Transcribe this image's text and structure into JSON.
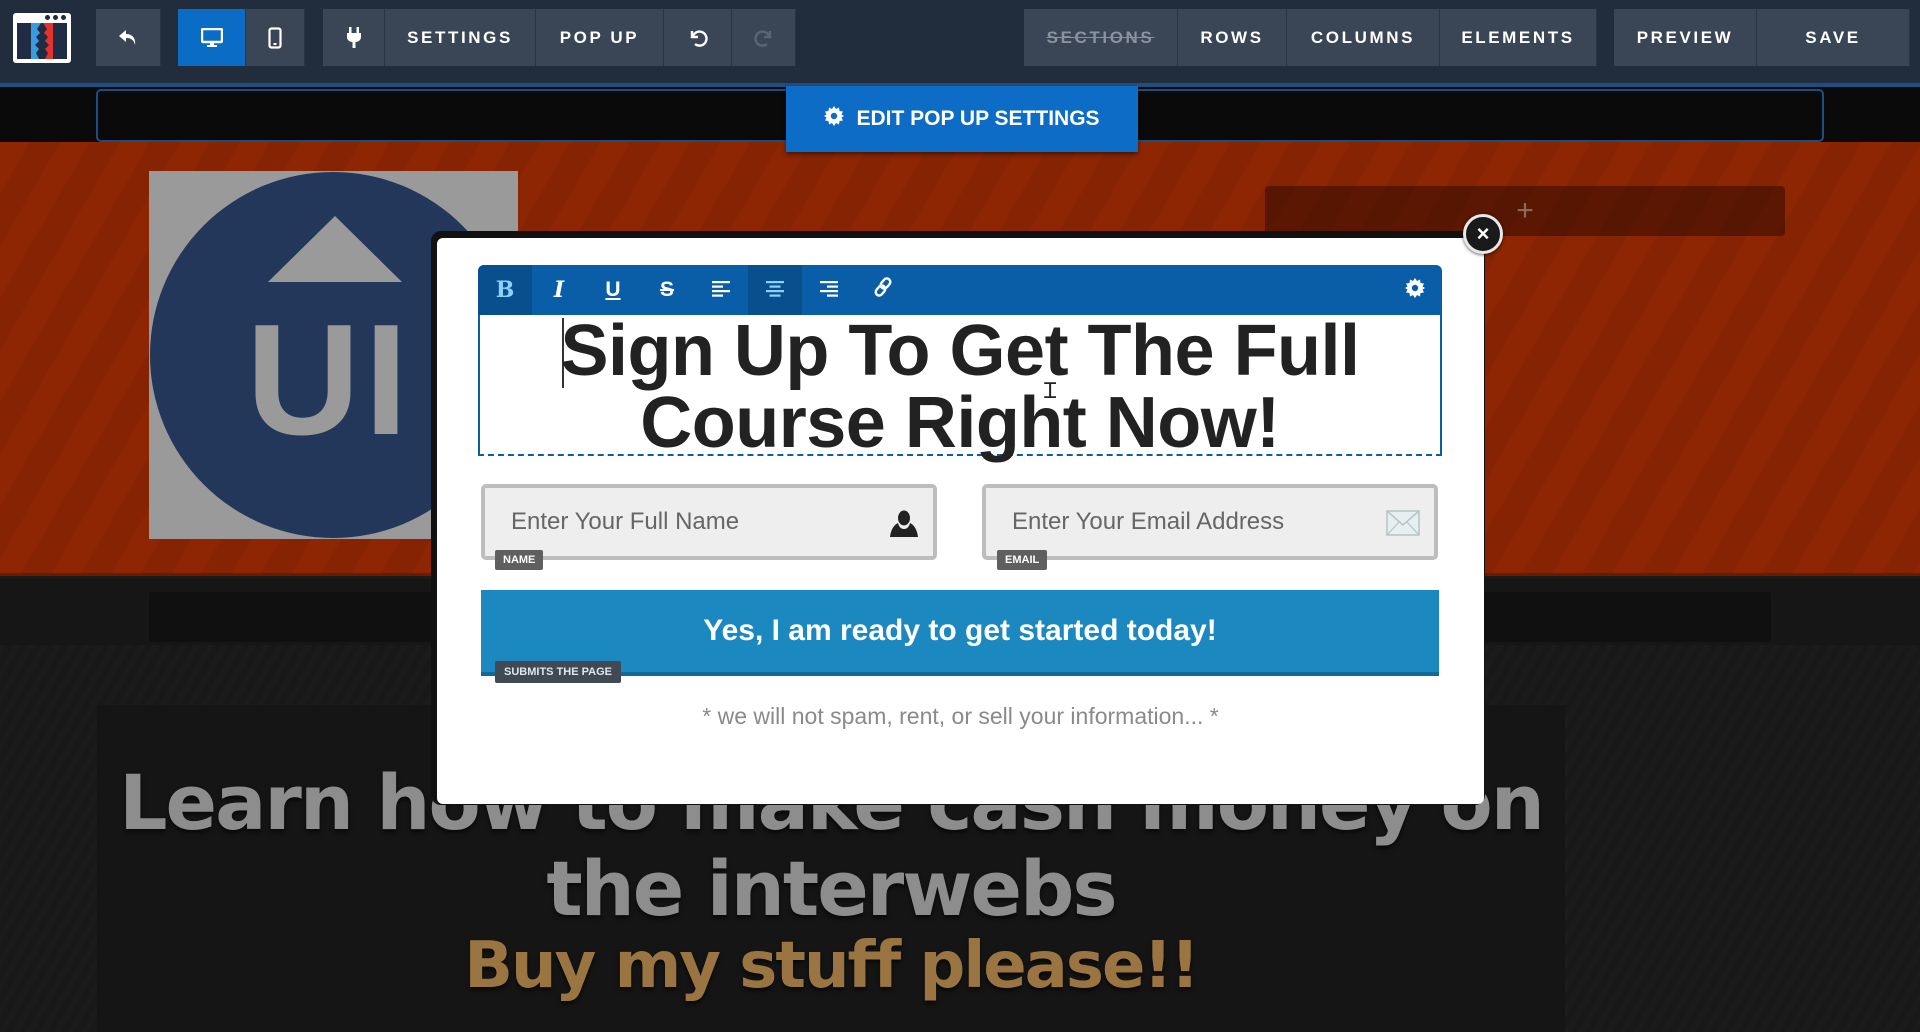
{
  "toolbar": {
    "logo_icon": "clickfunnels-logo-icon",
    "back_icon": "undo-arrow-icon",
    "device_desktop_icon": "desktop-icon",
    "device_mobile_icon": "mobile-icon",
    "plugin_icon": "plug-icon",
    "settings_label": "SETTINGS",
    "popup_label": "POP UP",
    "undo_icon": "undo-icon",
    "redo_icon": "redo-icon",
    "sections_label": "SECTIONS",
    "rows_label": "ROWS",
    "columns_label": "COLUMNS",
    "elements_label": "ELEMENTS",
    "preview_label": "PREVIEW",
    "save_label": "SAVE",
    "active_device": "desktop"
  },
  "edit_popup_settings": {
    "label": "EDIT POP UP SETTINGS",
    "icon": "gear-icon"
  },
  "background_page": {
    "hero_image_text": "UI",
    "add_slot_symbol": "+",
    "headline": "Learn how to make cash money on the interwebs",
    "subheadline": "Buy my stuff please!!"
  },
  "popup": {
    "close_symbol": "×",
    "editor_toolbar": {
      "buttons": [
        {
          "name": "bold",
          "glyph": "B",
          "active": true
        },
        {
          "name": "italic",
          "glyph": "I",
          "active": false
        },
        {
          "name": "underline",
          "glyph": "U",
          "active": false
        },
        {
          "name": "strikethrough",
          "glyph": "S",
          "active": false
        },
        {
          "name": "align-left",
          "glyph": "≡",
          "active": false
        },
        {
          "name": "align-center",
          "glyph": "≡",
          "active": true
        },
        {
          "name": "align-right",
          "glyph": "≡",
          "active": false
        },
        {
          "name": "link",
          "glyph": "🔗",
          "active": false
        }
      ],
      "settings_icon": "gear-icon"
    },
    "headline": "Sign Up To Get The Full Course Right Now!",
    "name_field": {
      "placeholder": "Enter Your Full Name",
      "tag": "NAME",
      "icon": "user-icon"
    },
    "email_field": {
      "placeholder": "Enter Your Email Address",
      "tag": "EMAIL",
      "icon": "envelope-icon"
    },
    "submit_button": {
      "label": "Yes, I am ready to get started today!",
      "tag": "SUBMITS THE PAGE"
    },
    "disclaimer": "* we will not spam, rent, or sell your information... *"
  },
  "colors": {
    "toolbar_bg": "#212c3d",
    "toolbar_button": "#3a4555",
    "accent_blue": "#0b6cc6",
    "editor_blue": "#0a5ea8",
    "submit_blue": "#1b88c0",
    "hero_orange": "#8e2503",
    "subheadline_gold": "#9a7541"
  }
}
